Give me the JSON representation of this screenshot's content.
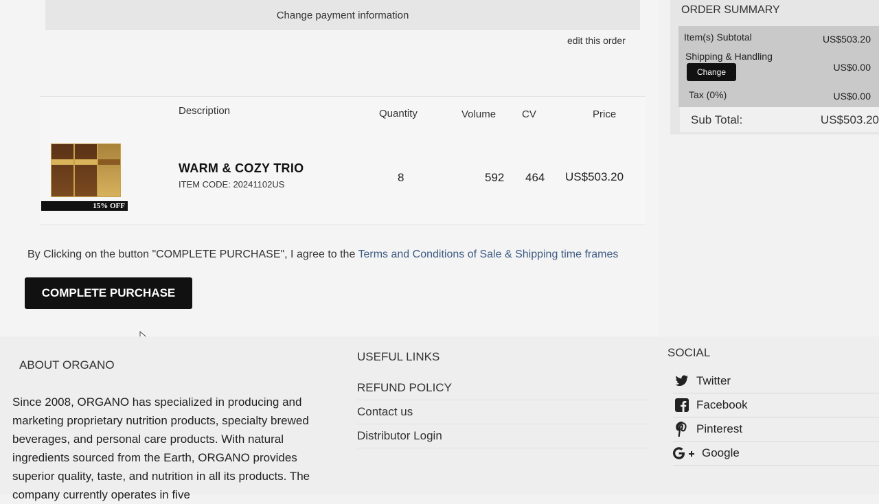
{
  "payment": {
    "change_label": "Change payment information"
  },
  "order": {
    "edit_label": "edit this order"
  },
  "cart": {
    "headers": {
      "description": "Description",
      "quantity": "Quantity",
      "volume": "Volume",
      "cv": "CV",
      "price": "Price"
    },
    "items": [
      {
        "name": "WARM & COZY TRIO",
        "code": "ITEM CODE: 20241102US",
        "badge": "15% OFF",
        "quantity": "8",
        "volume": "592",
        "cv": "464",
        "price": "US$503.20"
      }
    ]
  },
  "agreement": {
    "text": "By Clicking on the button \"COMPLETE PURCHASE\", I agree to the ",
    "link": "Terms and Conditions of Sale & Shipping time frames"
  },
  "complete_button": "COMPLETE PURCHASE",
  "summary": {
    "title": "ORDER SUMMARY",
    "items_subtotal_label": "Item(s) Subtotal",
    "items_subtotal_value": "US$503.20",
    "shipping_label": "Shipping & Handling",
    "shipping_change": "Change",
    "shipping_value": "US$0.00",
    "tax_label": "Tax (0%)",
    "tax_value": "US$0.00",
    "subtotal_label": "Sub Total:",
    "subtotal_value": "US$503.20"
  },
  "footer": {
    "about_title": "ABOUT ORGANO",
    "about_text": "Since 2008, ORGANO has specialized in producing and marketing proprietary nutrition products, specialty brewed beverages, and personal care products. With natural ingredients sourced from the Earth, ORGANO provides superior quality, taste, and nutrition in all its products. The company currently operates in five",
    "useful_title": "USEFUL LINKS",
    "useful_links": [
      "REFUND POLICY",
      "Contact us",
      "Distributor Login"
    ],
    "social_title": "SOCIAL",
    "social_links": [
      {
        "label": "Twitter",
        "icon": "twitter-icon"
      },
      {
        "label": "Facebook",
        "icon": "facebook-icon"
      },
      {
        "label": "Pinterest",
        "icon": "pinterest-icon"
      },
      {
        "label": "Google",
        "icon": "google-plus-icon"
      }
    ]
  },
  "colors": {
    "link": "#3d5a82",
    "button": "#111111"
  }
}
